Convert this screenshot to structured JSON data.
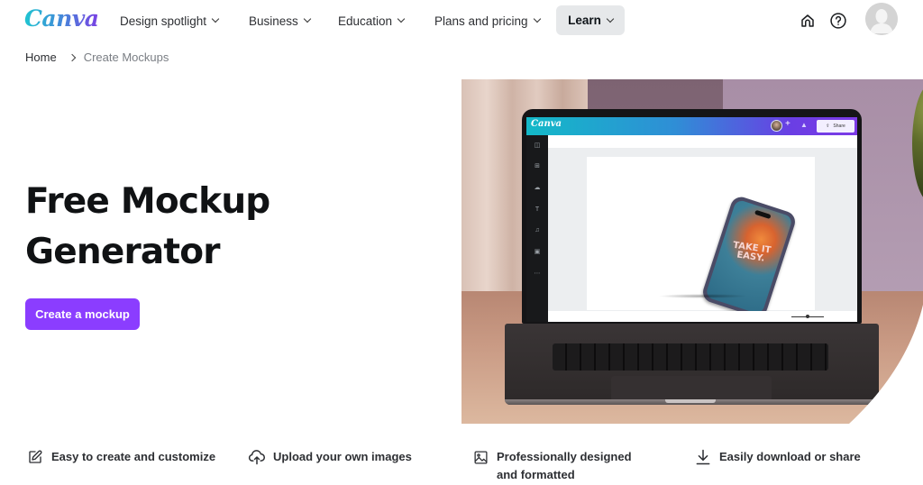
{
  "header": {
    "logo": "Canva",
    "nav": [
      {
        "label": "Design spotlight",
        "has_dropdown": true,
        "active": false
      },
      {
        "label": "Business",
        "has_dropdown": true,
        "active": false
      },
      {
        "label": "Education",
        "has_dropdown": true,
        "active": false
      },
      {
        "label": "Plans and pricing",
        "has_dropdown": true,
        "active": false
      },
      {
        "label": "Learn",
        "has_dropdown": true,
        "active": true
      }
    ],
    "icons": [
      "home-icon",
      "help-icon",
      "avatar"
    ]
  },
  "breadcrumb": {
    "items": [
      "Home",
      "Create Mockups"
    ]
  },
  "hero": {
    "title_line1": "Free Mockup",
    "title_line2": "Generator",
    "cta_label": "Create a mockup",
    "accent_color": "#8b3dff",
    "image": {
      "description": "Laptop on desk showing Canva editor with a phone mockup",
      "editor_logo": "Canva",
      "editor_share_label": "Share",
      "phone_text_line1": "TAKE IT",
      "phone_text_line2": "EASY."
    }
  },
  "features": [
    {
      "icon": "edit-icon",
      "label": "Easy to create and customize"
    },
    {
      "icon": "upload-cloud-icon",
      "label": "Upload your own images"
    },
    {
      "icon": "image-icon",
      "label": "Professionally designed and formatted"
    },
    {
      "icon": "download-icon",
      "label": "Easily download or share"
    }
  ]
}
